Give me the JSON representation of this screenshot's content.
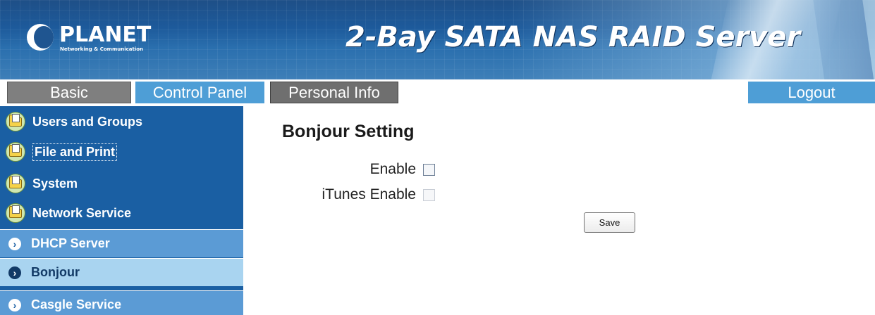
{
  "header": {
    "logo_text": "PLANET",
    "logo_subtext": "Networking & Communication",
    "product_title": "2-Bay SATA NAS RAID Server"
  },
  "tabs": {
    "basic": "Basic",
    "control_panel": "Control Panel",
    "personal_info": "Personal Info",
    "logout": "Logout"
  },
  "sidebar": {
    "groups": [
      {
        "label": "Users and Groups"
      },
      {
        "label": "File and Print"
      },
      {
        "label": "System"
      },
      {
        "label": "Network Service"
      }
    ],
    "sub_items": [
      {
        "label": "DHCP Server",
        "active": false
      },
      {
        "label": "Bonjour",
        "active": true
      },
      {
        "label": "Casgle Service",
        "active": false
      }
    ],
    "arrow_glyph": "›"
  },
  "main": {
    "title": "Bonjour Setting",
    "fields": [
      {
        "label": "Enable",
        "checked": false,
        "enabled": true
      },
      {
        "label": "iTunes Enable",
        "checked": false,
        "enabled": false
      }
    ],
    "save_label": "Save"
  },
  "colors": {
    "sidebar_bg": "#1a5fa3",
    "subitem_bg": "#5b9bd5",
    "subitem_active_bg": "#a9d4f0",
    "tab_blue": "#4e9ed6",
    "tab_gray": "#7f7f7f"
  },
  "icons": {
    "group_icon": "folder-user-icon",
    "sub_arrow": "chevron-right-circle-icon"
  }
}
